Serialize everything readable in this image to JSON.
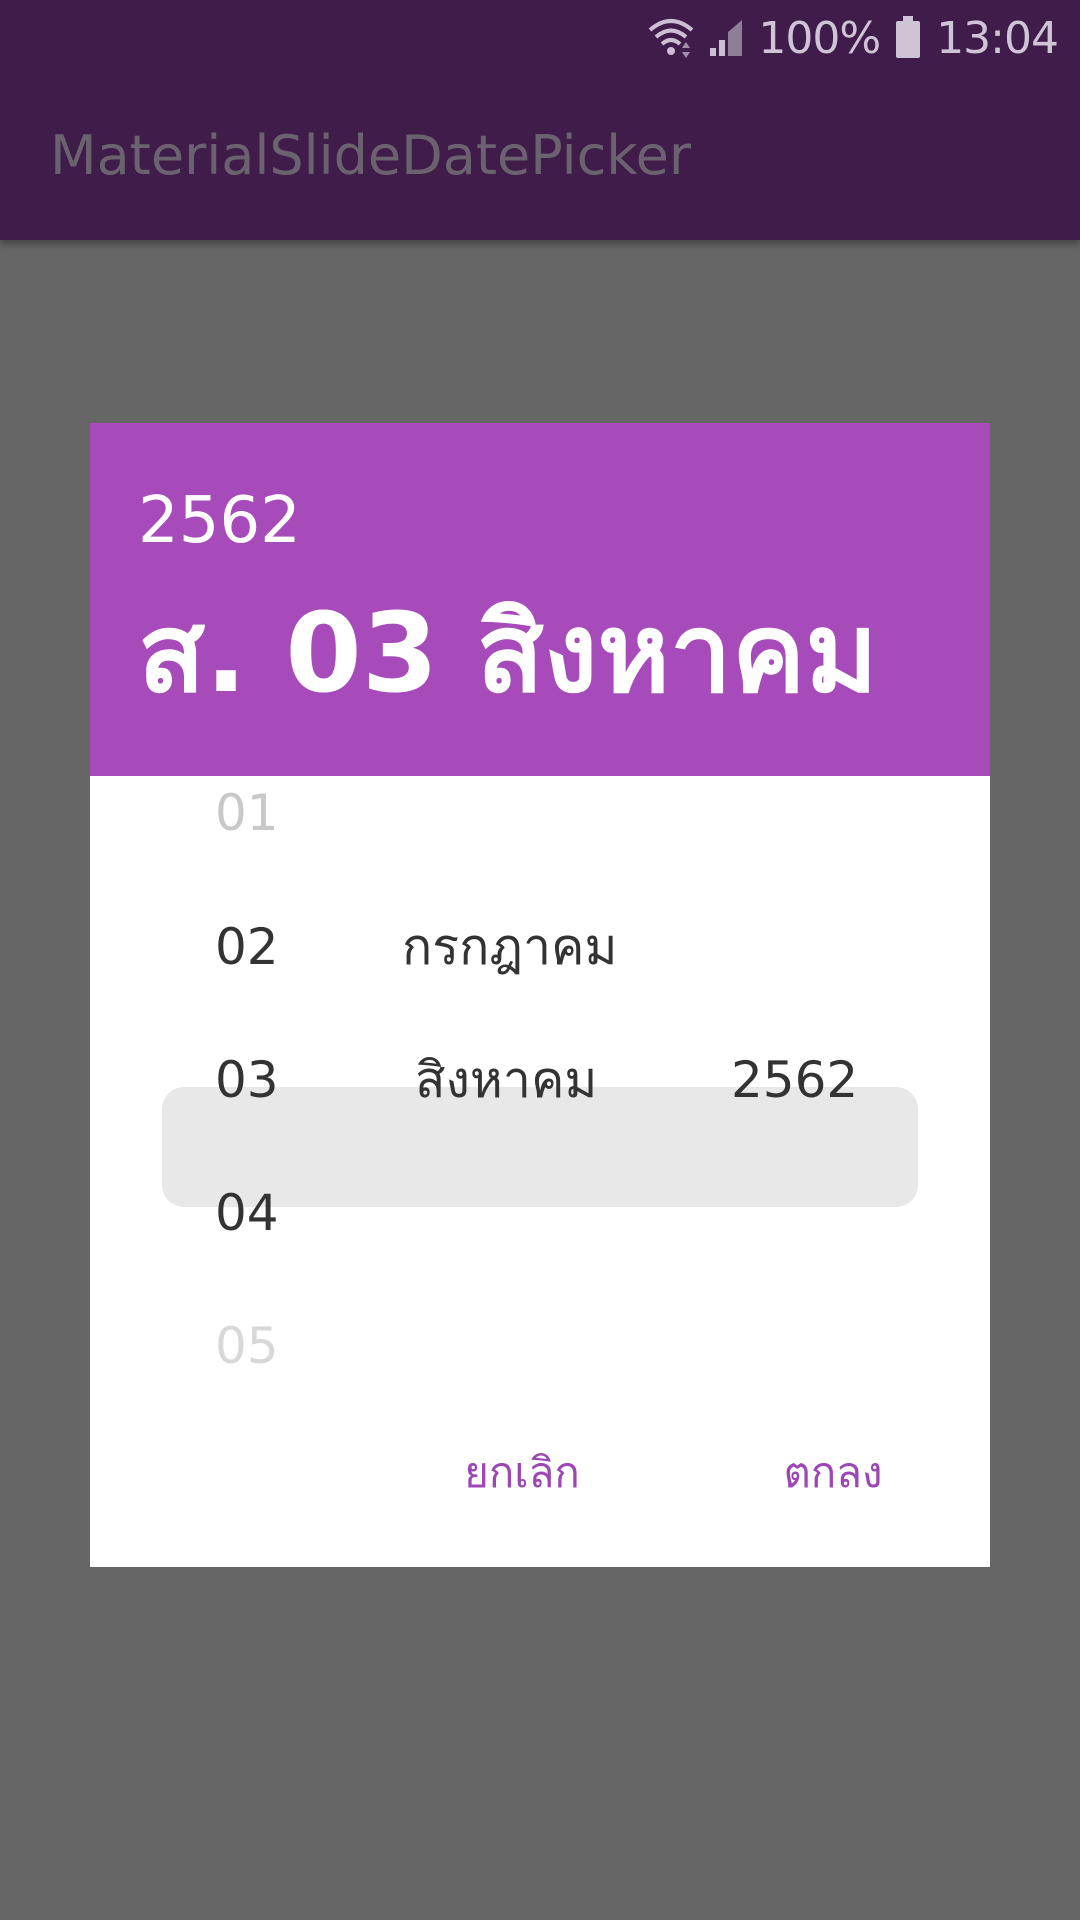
{
  "status_bar": {
    "battery": "100%",
    "time": "13:04",
    "icons": [
      "wifi-icon",
      "signal-icon",
      "battery-icon"
    ]
  },
  "app_bar": {
    "title": "MaterialSlideDatePicker"
  },
  "dialog": {
    "header": {
      "year": "2562",
      "date": "ส. 03 สิงหาคม"
    },
    "picker": {
      "days": [
        "01",
        "02",
        "03",
        "04",
        "05"
      ],
      "selected_day": "03",
      "months_visible": [
        "กรกฎาคม",
        "สิงหาคม"
      ],
      "selected_month": "สิงหาคม",
      "selected_year": "2562"
    },
    "buttons": {
      "cancel": "ยกเลิก",
      "ok": "ตกลง"
    }
  },
  "colors": {
    "topbar": "#3f1c4a",
    "header": "#a74bbb",
    "accent": "#9c47b3",
    "scrim": "#666666"
  }
}
